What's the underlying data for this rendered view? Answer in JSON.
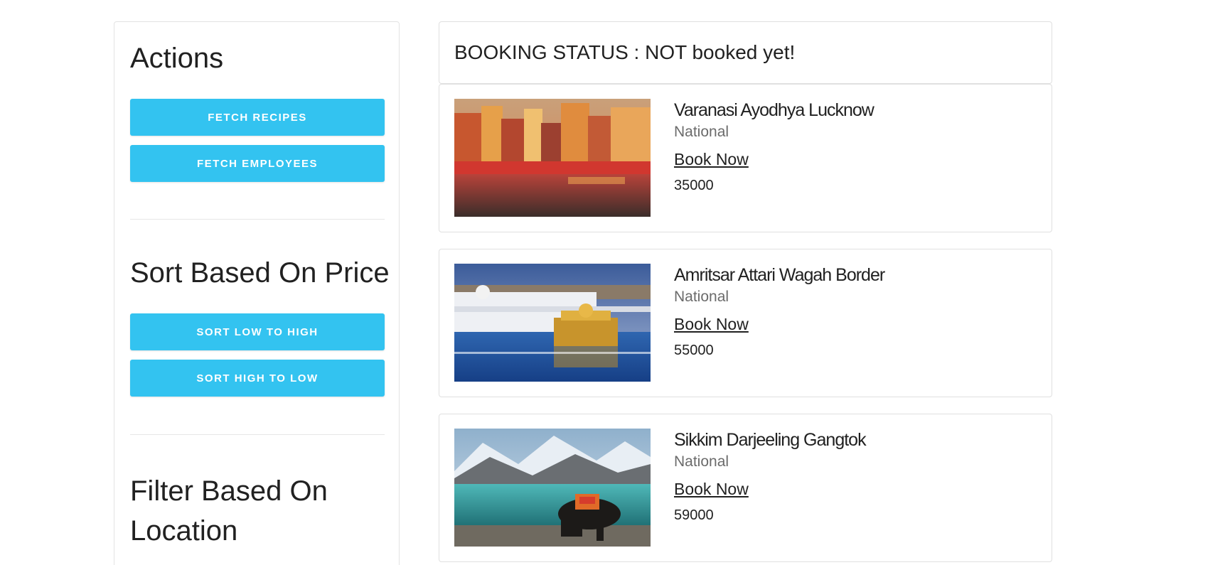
{
  "sidebar": {
    "actions": {
      "title": "Actions",
      "fetch_recipes_label": "FETCH RECIPES",
      "fetch_employees_label": "FETCH EMPLOYEES"
    },
    "sort": {
      "title": "Sort Based On Price",
      "low_to_high_label": "SORT LOW TO HIGH",
      "high_to_low_label": "SORT HIGH TO LOW"
    },
    "filter": {
      "title_line1": "Filter Based On",
      "title_line2": "Location"
    }
  },
  "booking": {
    "status_text": "BOOKING STATUS : NOT booked yet!"
  },
  "tours": [
    {
      "name": "Varanasi Ayodhya Lucknow",
      "type": "National",
      "book_label": "Book Now",
      "price": "35000",
      "image_icon": "varanasi-ghats-image"
    },
    {
      "name": "Amritsar Attari Wagah Border",
      "type": "National",
      "book_label": "Book Now",
      "price": "55000",
      "image_icon": "golden-temple-image"
    },
    {
      "name": "Sikkim Darjeeling Gangtok",
      "type": "National",
      "book_label": "Book Now",
      "price": "59000",
      "image_icon": "mountain-lake-yak-image"
    }
  ],
  "colors": {
    "button_bg": "#33c3f0",
    "button_text": "#ffffff",
    "border": "#e0e0e0"
  }
}
